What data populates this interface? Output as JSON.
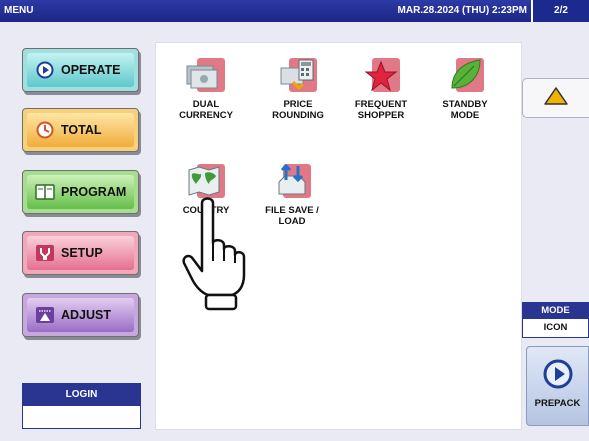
{
  "header": {
    "title": "MENU",
    "datetime": "MAR.28.2024 (THU)  2:23PM",
    "page": "2/2"
  },
  "sidebar": {
    "buttons": [
      {
        "label": "OPERATE"
      },
      {
        "label": "TOTAL"
      },
      {
        "label": "PROGRAM"
      },
      {
        "label": "SETUP"
      },
      {
        "label": "ADJUST"
      }
    ],
    "login": {
      "label": "LOGIN",
      "value": ""
    }
  },
  "icons": [
    {
      "line1": "DUAL",
      "line2": "CURRENCY"
    },
    {
      "line1": "PRICE",
      "line2": "ROUNDING"
    },
    {
      "line1": "FREQUENT",
      "line2": "SHOPPER"
    },
    {
      "line1": "STANDBY",
      "line2": "MODE"
    },
    {
      "line1": "COUNTRY",
      "line2": ""
    },
    {
      "line1": "FILE SAVE /",
      "line2": "LOAD"
    }
  ],
  "right": {
    "mode_label": "MODE",
    "mode_value": "ICON",
    "prepack_label": "PREPACK"
  }
}
